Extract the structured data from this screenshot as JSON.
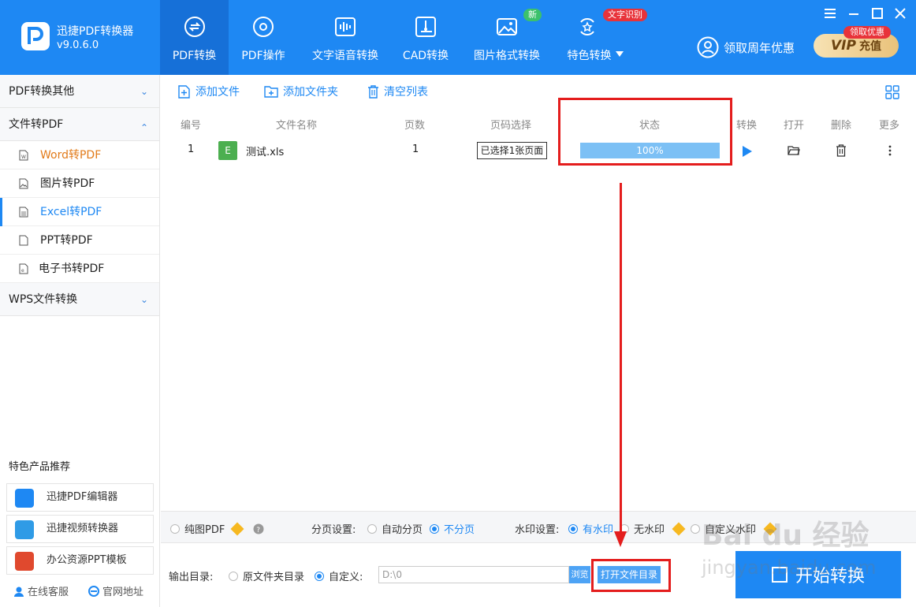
{
  "app": {
    "name": "迅捷PDF转换器",
    "version": "v9.0.6.0"
  },
  "nav": {
    "tabs": [
      {
        "label": "PDF转换",
        "icon": "pdf-convert-icon",
        "active": true
      },
      {
        "label": "PDF操作",
        "icon": "gear-circle-icon"
      },
      {
        "label": "文字语音转换",
        "icon": "sound-wave-icon"
      },
      {
        "label": "CAD转换",
        "icon": "cad-icon"
      },
      {
        "label": "图片格式转换",
        "icon": "image-icon",
        "badge": "新"
      },
      {
        "label": "特色转换",
        "icon": "sparkle-box-icon",
        "badge": "文字识别"
      }
    ],
    "promo": "领取周年优惠",
    "vip": {
      "tag": "领取优惠",
      "v": "VIP",
      "label": "充值"
    }
  },
  "sidebar": {
    "groups": [
      {
        "label": "PDF转换其他",
        "chevron": "down"
      },
      {
        "label": "文件转PDF",
        "chevron": "up"
      },
      {
        "label": "WPS文件转换",
        "chevron": "down"
      }
    ],
    "items": [
      {
        "label": "Word转PDF",
        "icon": "word-file-icon"
      },
      {
        "label": "图片转PDF",
        "icon": "image-file-icon"
      },
      {
        "label": "Excel转PDF",
        "icon": "excel-file-icon"
      },
      {
        "label": "PPT转PDF",
        "icon": "ppt-file-icon"
      },
      {
        "label": "电子书转PDF",
        "icon": "ebook-file-icon"
      }
    ],
    "featured_title": "特色产品推荐",
    "featured": [
      {
        "label": "迅捷PDF编辑器"
      },
      {
        "label": "迅捷视频转换器"
      },
      {
        "label": "办公资源PPT模板"
      }
    ],
    "footer": {
      "service": "在线客服",
      "website": "官网地址"
    }
  },
  "toolbar": {
    "add_file": "添加文件",
    "add_folder": "添加文件夹",
    "clear_list": "清空列表"
  },
  "table": {
    "headers": [
      "编号",
      "文件名称",
      "页数",
      "页码选择",
      "状态",
      "转换",
      "打开",
      "删除",
      "更多"
    ],
    "rows": [
      {
        "index": "1",
        "file_icon_letter": "E",
        "name": "测试.xls",
        "pages": "1",
        "page_select": "已选择1张页面",
        "progress": 100,
        "status": "100%"
      }
    ]
  },
  "options": {
    "pure_pdf": "纯图PDF",
    "paging_label": "分页设置:",
    "paging_auto": "自动分页",
    "paging_none": "不分页",
    "watermark_label": "水印设置:",
    "watermark_yes": "有水印",
    "watermark_no": "无水印",
    "watermark_custom": "自定义水印"
  },
  "output": {
    "label": "输出目录:",
    "original": "原文件夹目录",
    "custom": "自定义:",
    "path": "D:\\0",
    "browse": "浏览",
    "open_dir": "打开文件目录"
  },
  "start_button": "开始转换",
  "watermark_text": {
    "line1": "Bai du 经验",
    "line2": "jingyan.baidu.com"
  },
  "colors": {
    "accent": "#1e88f3",
    "annotation_red": "#e41d1d"
  }
}
